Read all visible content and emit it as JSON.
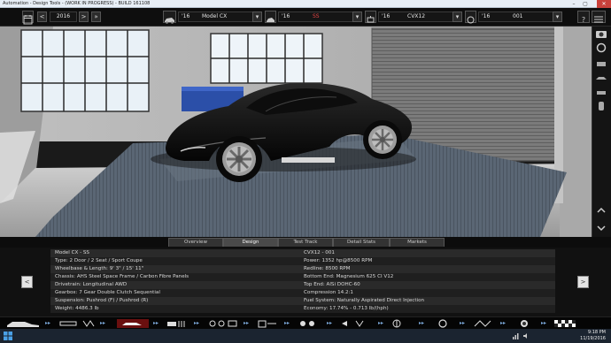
{
  "window": {
    "title": "Automation - Design Tools - (WORK IN PROGRESS) - BUILD 161108",
    "min_icon": "minimize-icon",
    "max_icon": "maximize-icon",
    "close_icon": "close-icon"
  },
  "topbar": {
    "year": "2016",
    "model_year": "'16",
    "model_name": "Model CX",
    "trim_year": "'16",
    "trim_name": "SS",
    "engine_year": "'16",
    "engine_name": "CVX12",
    "variant_year": "'16",
    "variant_name": "001"
  },
  "tabs": [
    {
      "label": "Overview"
    },
    {
      "label": "Design"
    },
    {
      "label": "Test Track"
    },
    {
      "label": "Detail Stats"
    },
    {
      "label": "Markets"
    }
  ],
  "info": {
    "left": [
      "Model CX - SS",
      "Type: 2 Door / 2 Seat / Sport Coupe",
      "Wheelbase & Length: 9' 3\" / 15' 11\"",
      "Chassis: AHS Steel Space Frame / Carbon Fibre Panels",
      "Drivetrain: Longitudinal AWD",
      "Gearbox: 7 Gear Double Clutch Sequential",
      "Suspension: Pushrod (F) / Pushrod (R)",
      "Weight: 4486.3 lb"
    ],
    "right": [
      "CVX12 - 001",
      "Power: 1352 hp@8500 RPM",
      "Redline: 8500 RPM",
      "Bottom End: Magnesium 625 CI V12",
      "Top End: AlSi DOHC-60",
      "Compression 14.2:1",
      "Fuel System: Naturally Aspirated Direct Injection",
      "Economy: 17.74% - 0.713 lb/(hph)"
    ]
  },
  "taskbar": {
    "time": "9:18 PM",
    "date": "11/19/2016"
  },
  "colors": {
    "accent_red": "#e24444",
    "panel_bg": "#111111",
    "active_tab": "#4a4a4a"
  }
}
